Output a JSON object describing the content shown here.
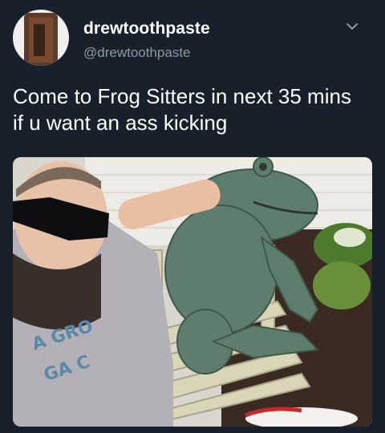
{
  "tweet": {
    "author": {
      "display_name": "drewtoothpaste",
      "handle": "@drewtoothpaste"
    },
    "text": "Come to Frog Sitters in next 35 mins if u want an ass kicking",
    "menu_icon": "chevron-down-icon"
  },
  "colors": {
    "background": "#17202b",
    "text": "#ffffff",
    "secondary_text": "#8899a6"
  }
}
